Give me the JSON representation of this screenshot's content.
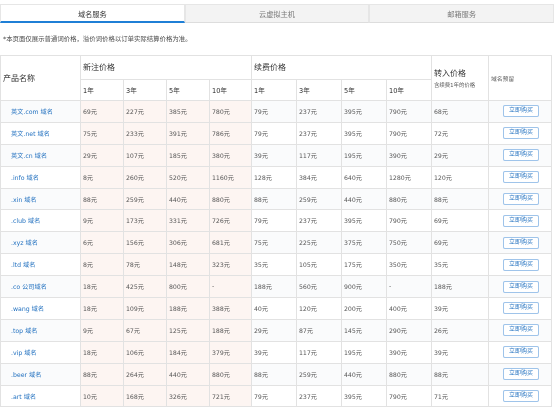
{
  "tabs": [
    {
      "label": "域名服务"
    },
    {
      "label": "云虚拟主机"
    },
    {
      "label": "邮箱服务"
    }
  ],
  "notice": "*本页面仅展示普通词价格，溢价词价格以订单实际结算价格为准。",
  "table": {
    "product_header": "产品名称",
    "register_header": "新注价格",
    "renew_header": "续费价格",
    "transfer_header": "转入价格",
    "transfer_sub": "含续费1年的价格",
    "action_header": "域名预留",
    "years": [
      "1年",
      "3年",
      "5年",
      "10年"
    ],
    "buy_label": "立即购买",
    "rows": [
      {
        "name": "英文.com 域名",
        "reg": [
          "69元",
          "227元",
          "385元",
          "780元"
        ],
        "renew": [
          "79元",
          "237元",
          "395元",
          "790元"
        ],
        "transfer": "68元"
      },
      {
        "name": "英文.net 域名",
        "reg": [
          "75元",
          "233元",
          "391元",
          "786元"
        ],
        "renew": [
          "79元",
          "237元",
          "395元",
          "790元"
        ],
        "transfer": "72元"
      },
      {
        "name": "英文.cn 域名",
        "reg": [
          "29元",
          "107元",
          "185元",
          "380元"
        ],
        "renew": [
          "39元",
          "117元",
          "195元",
          "390元"
        ],
        "transfer": "29元"
      },
      {
        "name": ".info 域名",
        "reg": [
          "8元",
          "260元",
          "520元",
          "1160元"
        ],
        "renew": [
          "128元",
          "384元",
          "640元",
          "1280元"
        ],
        "transfer": "120元"
      },
      {
        "name": ".xin 域名",
        "reg": [
          "88元",
          "259元",
          "440元",
          "880元"
        ],
        "renew": [
          "88元",
          "259元",
          "440元",
          "880元"
        ],
        "transfer": "88元"
      },
      {
        "name": ".club 域名",
        "reg": [
          "9元",
          "173元",
          "331元",
          "726元"
        ],
        "renew": [
          "79元",
          "237元",
          "395元",
          "790元"
        ],
        "transfer": "69元"
      },
      {
        "name": ".xyz 域名",
        "reg": [
          "6元",
          "156元",
          "306元",
          "681元"
        ],
        "renew": [
          "75元",
          "225元",
          "375元",
          "750元"
        ],
        "transfer": "69元"
      },
      {
        "name": ".ltd 域名",
        "reg": [
          "8元",
          "78元",
          "148元",
          "323元"
        ],
        "renew": [
          "35元",
          "105元",
          "175元",
          "350元"
        ],
        "transfer": "35元"
      },
      {
        "name": ".co 公司域名",
        "reg": [
          "18元",
          "425元",
          "800元",
          "-"
        ],
        "renew": [
          "188元",
          "560元",
          "900元",
          "-"
        ],
        "transfer": "188元"
      },
      {
        "name": ".wang 域名",
        "reg": [
          "18元",
          "109元",
          "188元",
          "388元"
        ],
        "renew": [
          "40元",
          "120元",
          "200元",
          "400元"
        ],
        "transfer": "39元"
      },
      {
        "name": ".top 域名",
        "reg": [
          "9元",
          "67元",
          "125元",
          "188元"
        ],
        "renew": [
          "29元",
          "87元",
          "145元",
          "290元"
        ],
        "transfer": "26元"
      },
      {
        "name": ".vip 域名",
        "reg": [
          "18元",
          "106元",
          "184元",
          "379元"
        ],
        "renew": [
          "39元",
          "117元",
          "195元",
          "390元"
        ],
        "transfer": "39元"
      },
      {
        "name": ".beer 域名",
        "reg": [
          "88元",
          "264元",
          "440元",
          "880元"
        ],
        "renew": [
          "88元",
          "259元",
          "440元",
          "880元"
        ],
        "transfer": "88元"
      },
      {
        "name": ".art 域名",
        "reg": [
          "10元",
          "168元",
          "326元",
          "721元"
        ],
        "renew": [
          "79元",
          "237元",
          "395元",
          "790元"
        ],
        "transfer": "71元"
      }
    ]
  }
}
